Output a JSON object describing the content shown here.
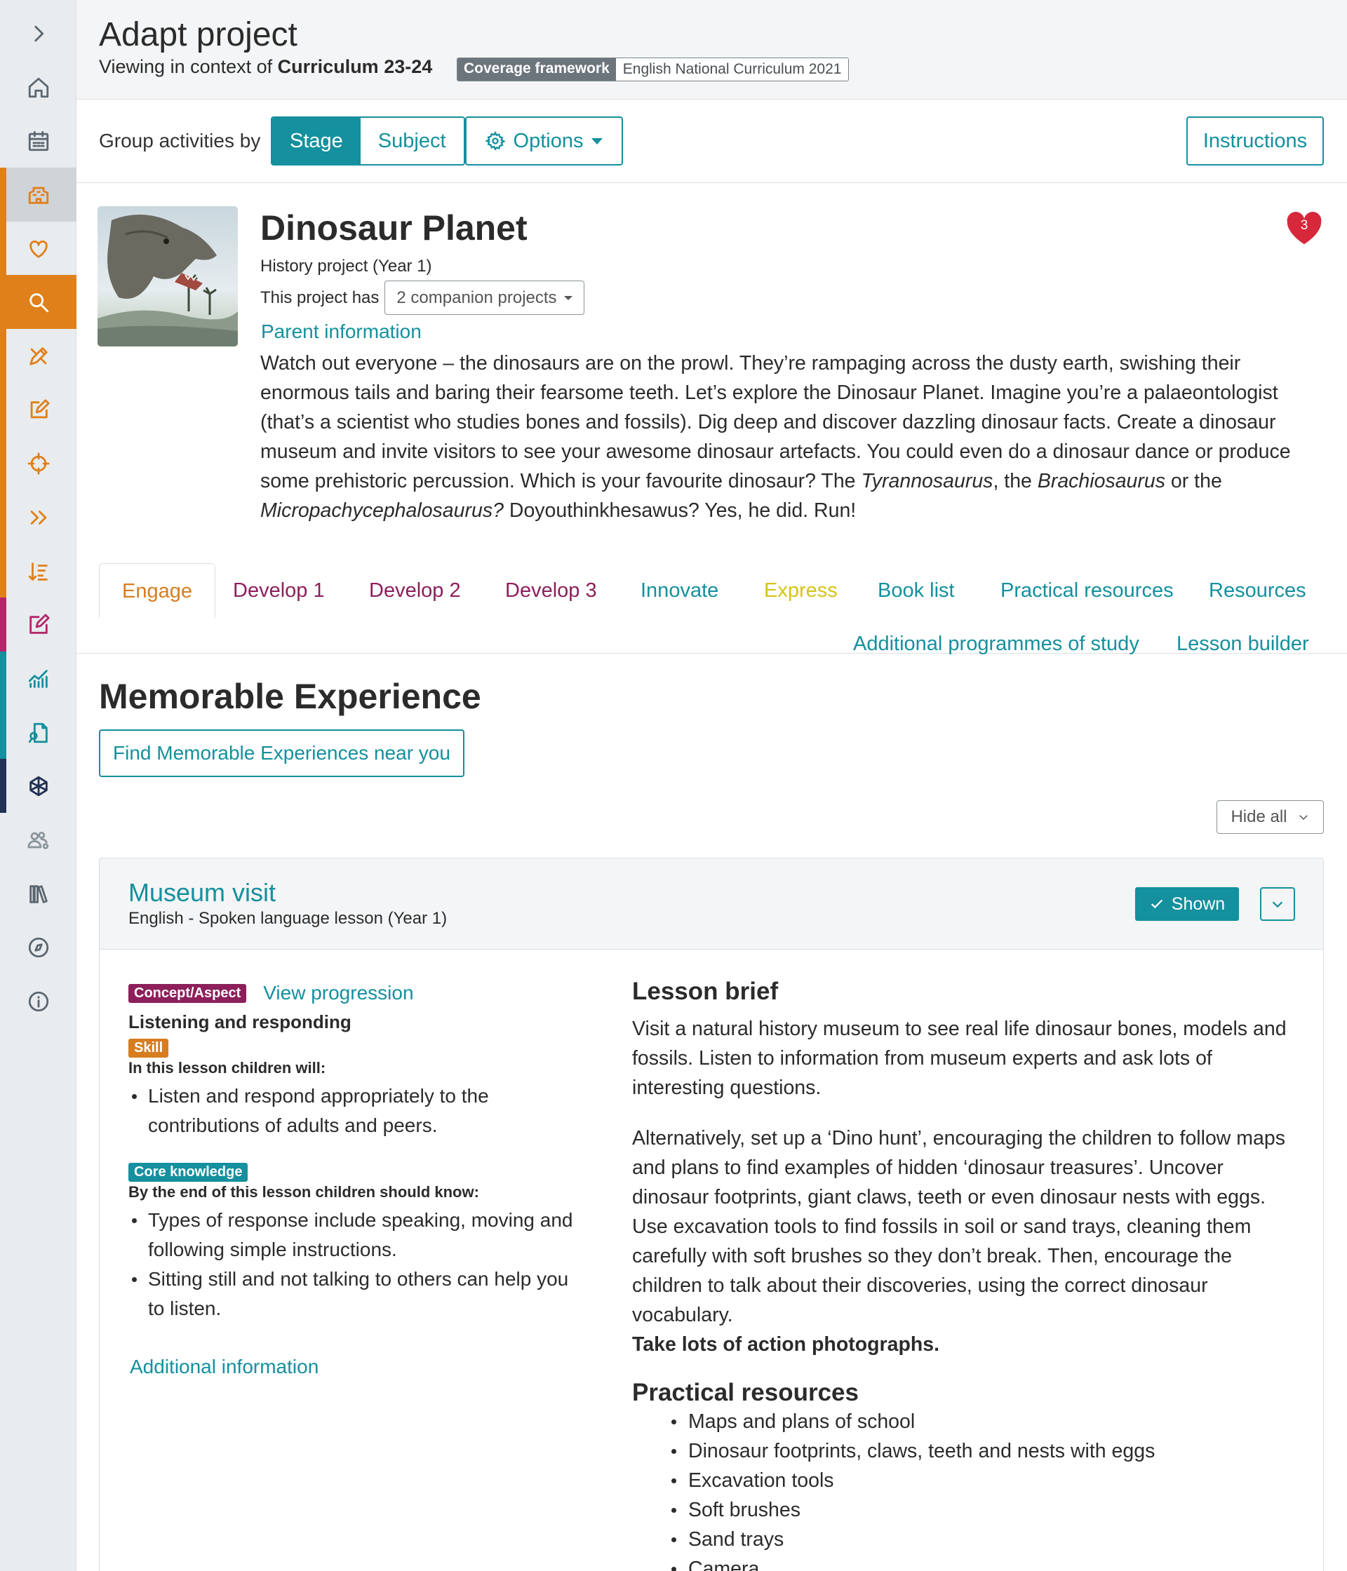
{
  "colors": {
    "teal": "#14909e",
    "orange": "#d77c1f",
    "purple": "#8d1f5a",
    "yellow": "#d5c41a"
  },
  "sidebar": {
    "items": [
      {
        "icon": "chevron-right-icon"
      },
      {
        "icon": "home-icon"
      },
      {
        "icon": "calendar-icon"
      },
      {
        "icon": "school-icon"
      },
      {
        "icon": "heart-icon"
      },
      {
        "icon": "search-icon"
      },
      {
        "icon": "pencil-ruler-icon"
      },
      {
        "icon": "edit-icon"
      },
      {
        "icon": "target-icon"
      },
      {
        "icon": "double-chevron-icon"
      },
      {
        "icon": "sort-list-icon"
      },
      {
        "icon": "pen-square-icon"
      },
      {
        "icon": "chart-icon"
      },
      {
        "icon": "document-search-icon"
      },
      {
        "icon": "network-icon"
      },
      {
        "icon": "users-settings-icon"
      },
      {
        "icon": "books-icon"
      },
      {
        "icon": "compass-icon"
      },
      {
        "icon": "info-icon"
      }
    ]
  },
  "header": {
    "title": "Adapt project",
    "context_prefix": "Viewing in context of",
    "context_value": "Curriculum 23-24",
    "coverage_key": "Coverage framework",
    "coverage_value": "English National Curriculum 2021"
  },
  "toolbar": {
    "group_label": "Group activities by",
    "group_options": [
      "Stage",
      "Subject"
    ],
    "group_selected": "Stage",
    "options_label": "Options",
    "instructions_label": "Instructions"
  },
  "project": {
    "title": "Dinosaur Planet",
    "subtitle": "History project (Year 1)",
    "companion_prefix": "This project has",
    "companion_value": "2 companion projects",
    "favourites_count": "3",
    "parent_info": "Parent information",
    "description_parts": [
      "Watch out everyone – the dinosaurs are on the prowl. They’re rampaging across the dusty earth, swishing their enormous tails and baring their fearsome teeth. Let’s explore the Dinosaur Planet. Imagine you’re a palaeontologist (that’s a scientist who studies bones and fossils). Dig deep and discover dazzling dinosaur facts. Create a dinosaur museum and invite visitors to see your awesome dinosaur artefacts. You could even do a dinosaur dance or produce some prehistoric percussion. Which is your favourite dinosaur? The ",
      "Tyrannosaurus",
      ", the ",
      "Brachiosaurus",
      " or the ",
      "Micropachycephalosaurus?",
      " Doyouthinkhesawus? Yes, he did. Run!"
    ]
  },
  "tabs": [
    {
      "label": "Engage",
      "color": "#d77c1f",
      "active": true
    },
    {
      "label": "Develop 1",
      "color": "#8d1f5a"
    },
    {
      "label": "Develop 2",
      "color": "#8d1f5a"
    },
    {
      "label": "Develop 3",
      "color": "#8d1f5a"
    },
    {
      "label": "Innovate",
      "color": "#14909e"
    },
    {
      "label": "Express",
      "color": "#d5c41a"
    },
    {
      "label": "Book list",
      "color": "#14909e"
    },
    {
      "label": "Practical resources",
      "color": "#14909e"
    },
    {
      "label": "Resources",
      "color": "#14909e"
    },
    {
      "label": "Additional programmes of study",
      "color": "#14909e"
    },
    {
      "label": "Lesson builder",
      "color": "#14909e"
    }
  ],
  "section": {
    "title": "Memorable Experience",
    "find_button": "Find Memorable Experiences near you",
    "hide_all": "Hide all"
  },
  "lesson": {
    "title": "Museum visit",
    "subtitle": "English - Spoken language lesson (Year 1)",
    "shown_label": "Shown",
    "concept_badge": "Concept/Aspect",
    "view_progression": "View progression",
    "concept_name": "Listening and responding",
    "skill_badge": "Skill",
    "skill_head": "In this lesson children will:",
    "skill_items": [
      "Listen and respond appropriately to the contributions of adults and peers."
    ],
    "core_badge": "Core knowledge",
    "core_head": "By the end of this lesson children should know:",
    "core_items": [
      "Types of response include speaking, moving and following simple instructions.",
      "Sitting still and not talking to others can help you to listen."
    ],
    "additional_info": "Additional information",
    "brief_title": "Lesson brief",
    "brief_p1": "Visit a natural history museum to see real life dinosaur bones, models and fossils. Listen to information from museum experts and ask lots of interesting questions.",
    "brief_p2": "Alternatively, set up a ‘Dino hunt’, encouraging the children to follow maps and plans to find examples of hidden ‘dinosaur treasures’. Uncover dinosaur footprints, giant claws, teeth or even dinosaur nests with eggs. Use excavation tools to find fossils in soil or sand trays, cleaning them carefully with soft brushes so they don’t break. Then, encourage the children to talk about their discoveries, using the correct dinosaur vocabulary.",
    "brief_bold": "Take lots of action photographs.",
    "resources_title": "Practical resources",
    "resources": [
      "Maps and plans of school",
      "Dinosaur footprints, claws, teeth and nests with eggs",
      "Excavation tools",
      "Soft brushes",
      "Sand trays",
      "Camera"
    ]
  }
}
